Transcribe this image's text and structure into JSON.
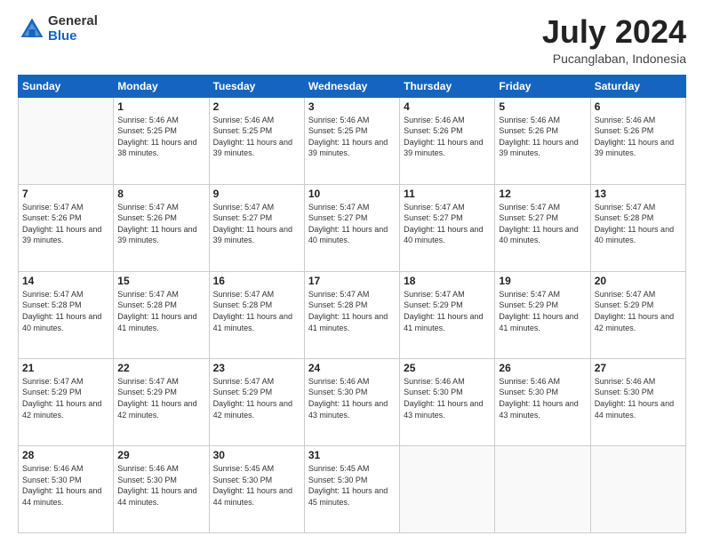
{
  "logo": {
    "general": "General",
    "blue": "Blue"
  },
  "header": {
    "month": "July 2024",
    "location": "Pucanglaban, Indonesia"
  },
  "weekdays": [
    "Sunday",
    "Monday",
    "Tuesday",
    "Wednesday",
    "Thursday",
    "Friday",
    "Saturday"
  ],
  "weeks": [
    [
      {
        "day": "",
        "sunrise": "",
        "sunset": "",
        "daylight": ""
      },
      {
        "day": "1",
        "sunrise": "Sunrise: 5:46 AM",
        "sunset": "Sunset: 5:25 PM",
        "daylight": "Daylight: 11 hours and 38 minutes."
      },
      {
        "day": "2",
        "sunrise": "Sunrise: 5:46 AM",
        "sunset": "Sunset: 5:25 PM",
        "daylight": "Daylight: 11 hours and 39 minutes."
      },
      {
        "day": "3",
        "sunrise": "Sunrise: 5:46 AM",
        "sunset": "Sunset: 5:25 PM",
        "daylight": "Daylight: 11 hours and 39 minutes."
      },
      {
        "day": "4",
        "sunrise": "Sunrise: 5:46 AM",
        "sunset": "Sunset: 5:26 PM",
        "daylight": "Daylight: 11 hours and 39 minutes."
      },
      {
        "day": "5",
        "sunrise": "Sunrise: 5:46 AM",
        "sunset": "Sunset: 5:26 PM",
        "daylight": "Daylight: 11 hours and 39 minutes."
      },
      {
        "day": "6",
        "sunrise": "Sunrise: 5:46 AM",
        "sunset": "Sunset: 5:26 PM",
        "daylight": "Daylight: 11 hours and 39 minutes."
      }
    ],
    [
      {
        "day": "7",
        "sunrise": "Sunrise: 5:47 AM",
        "sunset": "Sunset: 5:26 PM",
        "daylight": "Daylight: 11 hours and 39 minutes."
      },
      {
        "day": "8",
        "sunrise": "Sunrise: 5:47 AM",
        "sunset": "Sunset: 5:26 PM",
        "daylight": "Daylight: 11 hours and 39 minutes."
      },
      {
        "day": "9",
        "sunrise": "Sunrise: 5:47 AM",
        "sunset": "Sunset: 5:27 PM",
        "daylight": "Daylight: 11 hours and 39 minutes."
      },
      {
        "day": "10",
        "sunrise": "Sunrise: 5:47 AM",
        "sunset": "Sunset: 5:27 PM",
        "daylight": "Daylight: 11 hours and 40 minutes."
      },
      {
        "day": "11",
        "sunrise": "Sunrise: 5:47 AM",
        "sunset": "Sunset: 5:27 PM",
        "daylight": "Daylight: 11 hours and 40 minutes."
      },
      {
        "day": "12",
        "sunrise": "Sunrise: 5:47 AM",
        "sunset": "Sunset: 5:27 PM",
        "daylight": "Daylight: 11 hours and 40 minutes."
      },
      {
        "day": "13",
        "sunrise": "Sunrise: 5:47 AM",
        "sunset": "Sunset: 5:28 PM",
        "daylight": "Daylight: 11 hours and 40 minutes."
      }
    ],
    [
      {
        "day": "14",
        "sunrise": "Sunrise: 5:47 AM",
        "sunset": "Sunset: 5:28 PM",
        "daylight": "Daylight: 11 hours and 40 minutes."
      },
      {
        "day": "15",
        "sunrise": "Sunrise: 5:47 AM",
        "sunset": "Sunset: 5:28 PM",
        "daylight": "Daylight: 11 hours and 41 minutes."
      },
      {
        "day": "16",
        "sunrise": "Sunrise: 5:47 AM",
        "sunset": "Sunset: 5:28 PM",
        "daylight": "Daylight: 11 hours and 41 minutes."
      },
      {
        "day": "17",
        "sunrise": "Sunrise: 5:47 AM",
        "sunset": "Sunset: 5:28 PM",
        "daylight": "Daylight: 11 hours and 41 minutes."
      },
      {
        "day": "18",
        "sunrise": "Sunrise: 5:47 AM",
        "sunset": "Sunset: 5:29 PM",
        "daylight": "Daylight: 11 hours and 41 minutes."
      },
      {
        "day": "19",
        "sunrise": "Sunrise: 5:47 AM",
        "sunset": "Sunset: 5:29 PM",
        "daylight": "Daylight: 11 hours and 41 minutes."
      },
      {
        "day": "20",
        "sunrise": "Sunrise: 5:47 AM",
        "sunset": "Sunset: 5:29 PM",
        "daylight": "Daylight: 11 hours and 42 minutes."
      }
    ],
    [
      {
        "day": "21",
        "sunrise": "Sunrise: 5:47 AM",
        "sunset": "Sunset: 5:29 PM",
        "daylight": "Daylight: 11 hours and 42 minutes."
      },
      {
        "day": "22",
        "sunrise": "Sunrise: 5:47 AM",
        "sunset": "Sunset: 5:29 PM",
        "daylight": "Daylight: 11 hours and 42 minutes."
      },
      {
        "day": "23",
        "sunrise": "Sunrise: 5:47 AM",
        "sunset": "Sunset: 5:29 PM",
        "daylight": "Daylight: 11 hours and 42 minutes."
      },
      {
        "day": "24",
        "sunrise": "Sunrise: 5:46 AM",
        "sunset": "Sunset: 5:30 PM",
        "daylight": "Daylight: 11 hours and 43 minutes."
      },
      {
        "day": "25",
        "sunrise": "Sunrise: 5:46 AM",
        "sunset": "Sunset: 5:30 PM",
        "daylight": "Daylight: 11 hours and 43 minutes."
      },
      {
        "day": "26",
        "sunrise": "Sunrise: 5:46 AM",
        "sunset": "Sunset: 5:30 PM",
        "daylight": "Daylight: 11 hours and 43 minutes."
      },
      {
        "day": "27",
        "sunrise": "Sunrise: 5:46 AM",
        "sunset": "Sunset: 5:30 PM",
        "daylight": "Daylight: 11 hours and 44 minutes."
      }
    ],
    [
      {
        "day": "28",
        "sunrise": "Sunrise: 5:46 AM",
        "sunset": "Sunset: 5:30 PM",
        "daylight": "Daylight: 11 hours and 44 minutes."
      },
      {
        "day": "29",
        "sunrise": "Sunrise: 5:46 AM",
        "sunset": "Sunset: 5:30 PM",
        "daylight": "Daylight: 11 hours and 44 minutes."
      },
      {
        "day": "30",
        "sunrise": "Sunrise: 5:45 AM",
        "sunset": "Sunset: 5:30 PM",
        "daylight": "Daylight: 11 hours and 44 minutes."
      },
      {
        "day": "31",
        "sunrise": "Sunrise: 5:45 AM",
        "sunset": "Sunset: 5:30 PM",
        "daylight": "Daylight: 11 hours and 45 minutes."
      },
      {
        "day": "",
        "sunrise": "",
        "sunset": "",
        "daylight": ""
      },
      {
        "day": "",
        "sunrise": "",
        "sunset": "",
        "daylight": ""
      },
      {
        "day": "",
        "sunrise": "",
        "sunset": "",
        "daylight": ""
      }
    ]
  ]
}
